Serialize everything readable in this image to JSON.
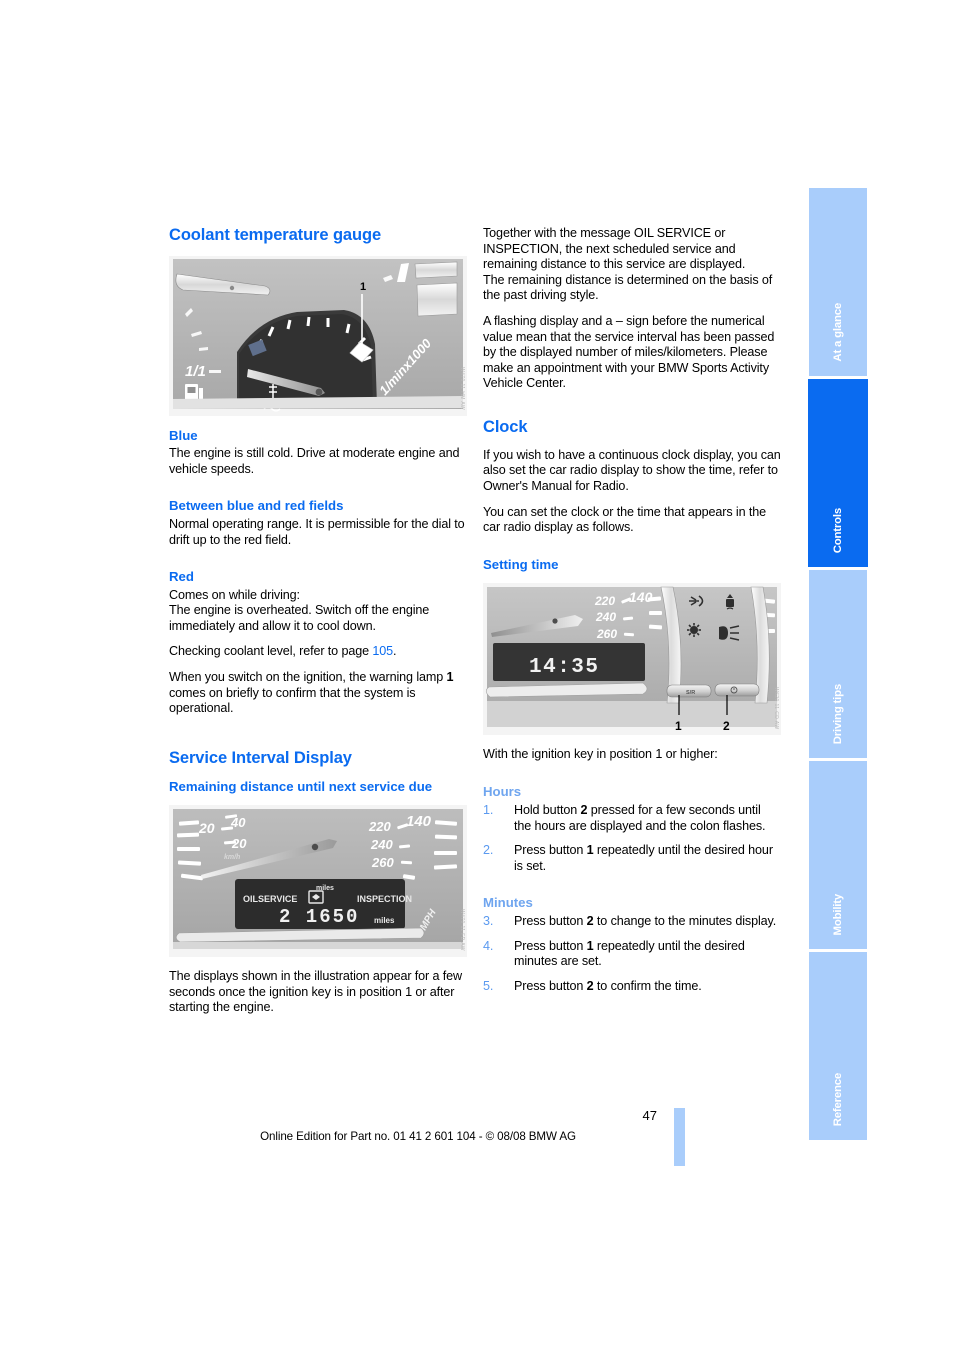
{
  "page": {
    "number": "47",
    "footer": "Online Edition for Part no. 01 41 2 601 104 - © 08/08 BMW AG"
  },
  "colors": {
    "heading_blue": "#0a6bf0",
    "light_blue": "#6fa5ef",
    "tab_inactive": "#a9cdfb",
    "tab_active": "#0a6bf0"
  },
  "left_column": {
    "section_title": "Coolant temperature gauge",
    "figure_coolant": {
      "caption_number": "1",
      "label_fuel": "1/1",
      "label_rpm": "1/minx1000"
    },
    "blue": {
      "heading": "Blue",
      "text": "The engine is still cold. Drive at moderate engine and vehicle speeds."
    },
    "between": {
      "heading": "Between blue and red fields",
      "text": "Normal operating range. It is permissible for the dial to drift up to the red field."
    },
    "red": {
      "heading": "Red",
      "text_line1": "Comes on while driving:",
      "text_line2": "The engine is overheated. Switch off the engine immediately and allow it to cool down.",
      "coolant_prefix": "Checking coolant level, refer to page ",
      "coolant_page": "105",
      "coolant_suffix": ".",
      "warning_pre": "When you switch on the ignition, the warning lamp ",
      "warning_num": "1",
      "warning_post": " comes on briefly to confirm that the system is operational."
    },
    "service_section_title": "Service Interval Display",
    "service_sub": "Remaining distance until next service due",
    "figure_service": {
      "oil_service": "OILSERVICE",
      "inspection": "INSPECTION",
      "value": "2 1650",
      "unit_top": "miles",
      "unit_bottom": "miles",
      "speed_20a": "20",
      "speed_40": "40",
      "speed_20b": "20",
      "unit_kmh": "km/h",
      "speed_220": "220",
      "speed_140": "140",
      "speed_240": "240",
      "speed_260": "260",
      "unit_mph": "MPH"
    },
    "service_note": "The displays shown in the illustration appear for a few seconds once the ignition key is in position 1 or after starting the engine."
  },
  "right_column": {
    "intro_p1": "Together with the message OIL SERVICE or INSPECTION, the next scheduled service and remaining distance to this service are displayed.",
    "intro_p2": "The remaining distance is determined on the basis of the past driving style.",
    "intro_p3": "A flashing display and a – sign before the numerical value mean that the service interval has been passed by the displayed number of miles/kilometers. Please make an appointment with your BMW Sports Activity Vehicle Center.",
    "clock_title": "Clock",
    "clock_p1": "If you wish to have a continuous clock display, you can also set the car radio display to show the time, refer to Owner's Manual for Radio.",
    "clock_p2": "You can set the clock or the time that appears in the car radio display as follows.",
    "setting_time_heading": "Setting time",
    "figure_clock": {
      "time": "14:35",
      "callout_1": "1",
      "callout_2": "2",
      "speed_220": "220",
      "speed_140": "140",
      "speed_240": "240",
      "speed_260": "260"
    },
    "ignition_note": "With the ignition key in position 1 or higher:",
    "hours_heading": "Hours",
    "minutes_heading": "Minutes",
    "steps": [
      {
        "n": "1.",
        "pre": "Hold button ",
        "b": "2",
        "post": " pressed for a few seconds until the hours are displayed and the colon flashes."
      },
      {
        "n": "2.",
        "pre": "Press button ",
        "b": "1",
        "post": " repeatedly until the desired hour is set."
      },
      {
        "n": "3.",
        "pre": "Press button ",
        "b": "2",
        "post": " to change to the minutes display."
      },
      {
        "n": "4.",
        "pre": "Press button ",
        "b": "1",
        "post": " repeatedly until the desired minutes are set."
      },
      {
        "n": "5.",
        "pre": "Press button ",
        "b": "2",
        "post": " to confirm the time."
      }
    ]
  },
  "tabs": [
    {
      "label": "At a glance",
      "active": false
    },
    {
      "label": "Controls",
      "active": true
    },
    {
      "label": "Driving tips",
      "active": false
    },
    {
      "label": "Mobility",
      "active": false
    },
    {
      "label": "Reference",
      "active": false
    }
  ]
}
